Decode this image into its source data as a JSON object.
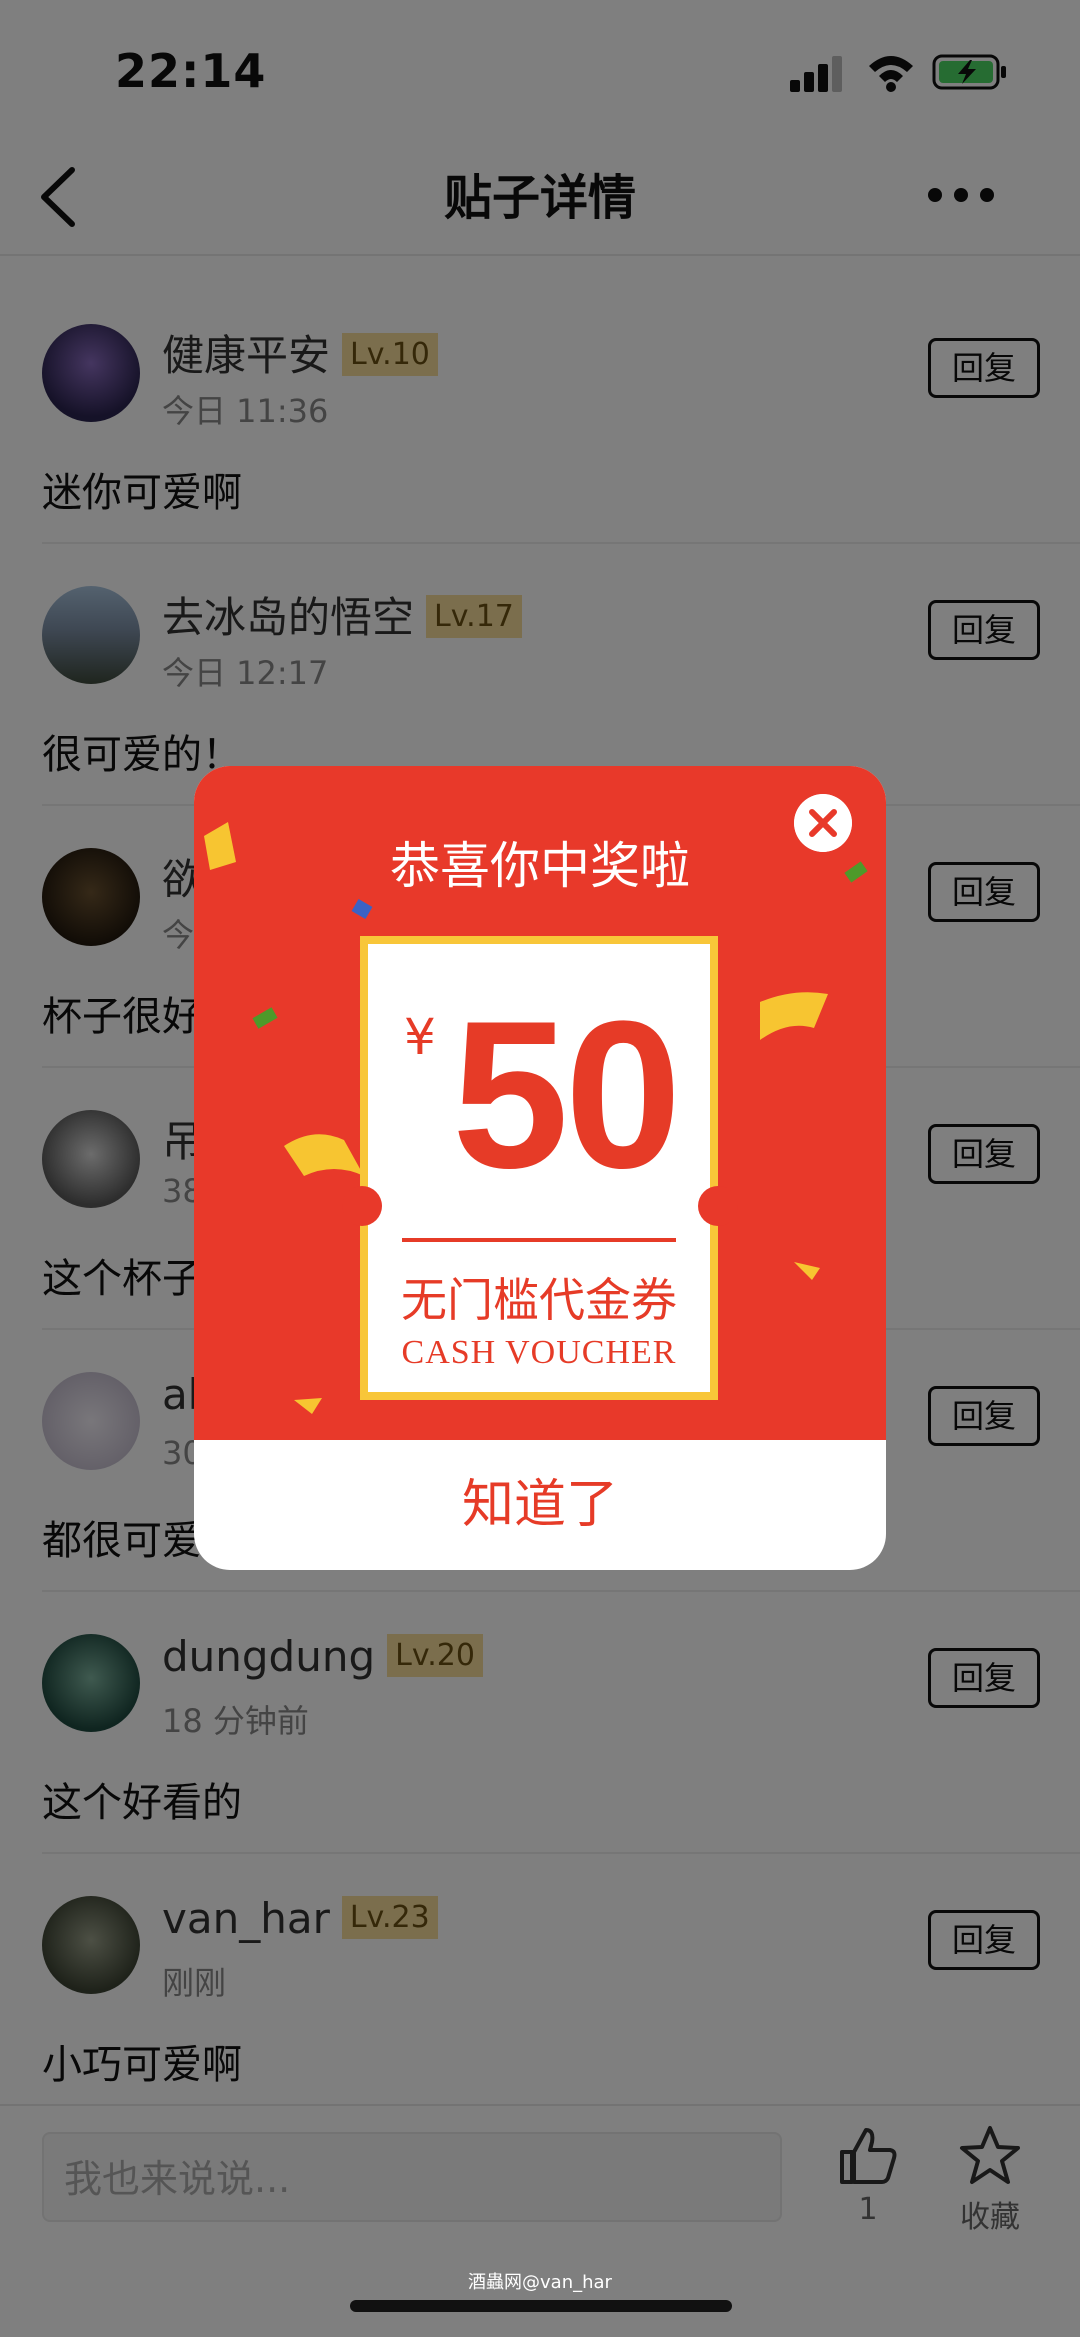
{
  "status_bar": {
    "time": "22:14"
  },
  "navbar": {
    "title": "贴子详情"
  },
  "comments": [
    {
      "user": "健康平安",
      "level": "Lv.10",
      "time": "今日 11:36",
      "text": "迷你可爱啊",
      "reply": "回复"
    },
    {
      "user": "去冰岛的悟空",
      "level": "Lv.17",
      "time": "今日 12:17",
      "text": "很可爱的！",
      "reply": "回复"
    },
    {
      "user": "欲",
      "level": "",
      "time": "今",
      "text": "杯子很好",
      "reply": "回复"
    },
    {
      "user": "吊",
      "level": "",
      "time": "38",
      "text": "这个杯子",
      "reply": "回复"
    },
    {
      "user": "ab",
      "level": "",
      "time": "30",
      "text": "都很可爱",
      "reply": "回复"
    },
    {
      "user": "dungdung",
      "level": "Lv.20",
      "time": "18 分钟前",
      "text": "这个好看的",
      "reply": "回复"
    },
    {
      "user": "van_har",
      "level": "Lv.23",
      "time": "刚刚",
      "text": "小巧可爱啊",
      "reply": "回复"
    }
  ],
  "bottom_bar": {
    "placeholder": "我也来说说...",
    "like_count": "1",
    "favorite_label": "收藏"
  },
  "watermark": "酒蟲网@van_har",
  "modal": {
    "title": "恭喜你中奖啦",
    "currency": "¥",
    "amount": "50",
    "voucher_name": "无门槛代金券",
    "voucher_en": "CASH VOUCHER",
    "confirm": "知道了"
  },
  "colors": {
    "accent": "#e8392a",
    "ticket_border": "#f8c639",
    "level_bg": "#f6dc9b"
  }
}
